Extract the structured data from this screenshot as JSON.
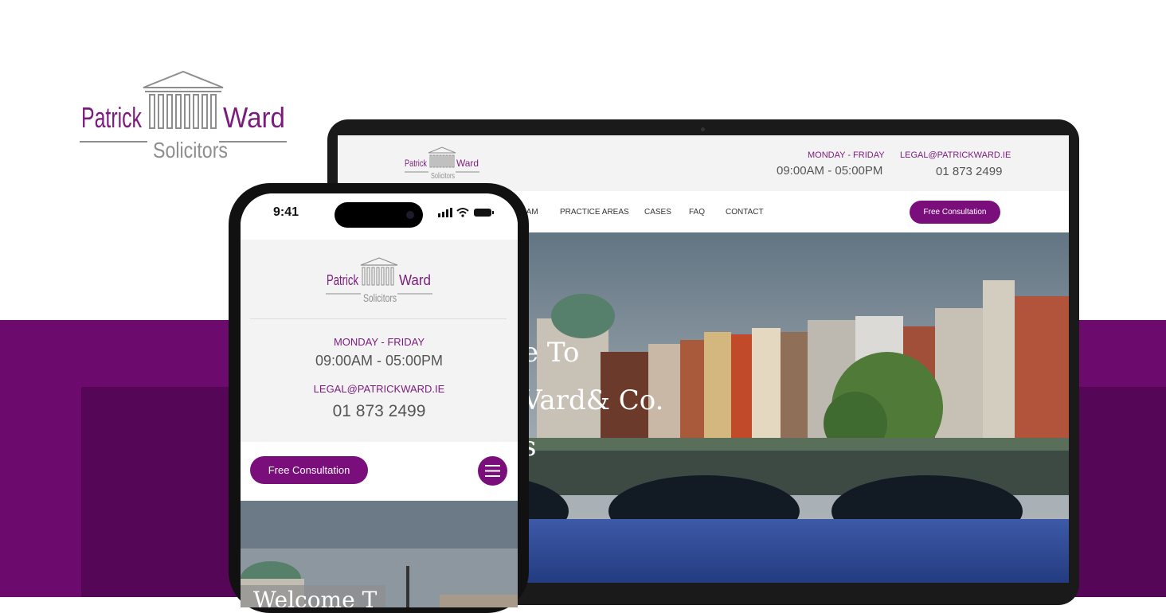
{
  "brand": {
    "name_left": "Patrick",
    "name_right": "Ward",
    "subtitle": "Solicitors"
  },
  "colors": {
    "brand_purple": "#7a0f7c",
    "band_purple": "#6d0a6e",
    "band_dark": "#560656"
  },
  "desktop": {
    "hours_label": "MONDAY - FRIDAY",
    "hours_value": "09:00AM - 05:00PM",
    "email_label": "LEGAL@PATRICKWARD.IE",
    "phone_value": "01 873 2499",
    "nav": [
      "EAM",
      "PRACTICE AREAS",
      "CASES",
      "FAQ",
      "CONTACT"
    ],
    "cta": "Free Consultation",
    "hero_lines": [
      "e To",
      "Vard& Co.",
      "s"
    ]
  },
  "mobile": {
    "status_time": "9:41",
    "hours_label": "MONDAY - FRIDAY",
    "hours_value": "09:00AM - 05:00PM",
    "email_label": "LEGAL@PATRICKWARD.IE",
    "phone_value": "01 873 2499",
    "cta": "Free Consultation",
    "menu_icon": "hamburger-icon",
    "hero_partial": "Welcome T"
  }
}
